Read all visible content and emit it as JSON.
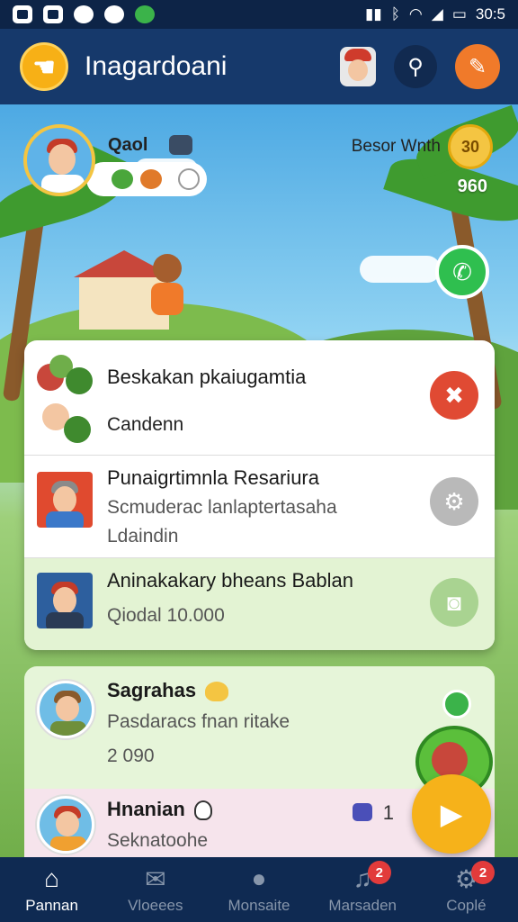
{
  "status_bar": {
    "time": "30:5",
    "icons": [
      "gallery-icon",
      "image-icon",
      "alarm-icon",
      "location-icon",
      "leaf-icon",
      "vibrate-icon",
      "bluetooth-icon",
      "wifi-icon",
      "signal-icon",
      "battery-icon"
    ]
  },
  "header": {
    "title": "Inagardoani",
    "back_icon": "back-hand-icon",
    "search_icon": "search-icon",
    "edit_icon": "pencil-icon"
  },
  "profile": {
    "name": "Qaol",
    "best_label": "Besor Wnth",
    "coin_value": "30",
    "coin_sub": "960"
  },
  "main_card": {
    "section1": {
      "title": "Beskakan pkaiugamtia",
      "subtitle": "Candenn"
    },
    "section2": {
      "title": "Punaigrtimnla Resariura",
      "line2": "Scmuderac lanlaptertasaha",
      "line3": "Ldaindin"
    },
    "section3": {
      "title": "Aninakakary bheans Bablan",
      "subtitle": "Qiodal 10.000"
    }
  },
  "lower_card": {
    "row1": {
      "title": "Sagrahas",
      "subtitle": "Pasdaracs fnan ritake",
      "value": "2 090"
    },
    "row2": {
      "title": "Hnanian",
      "subtitle": "Seknatoohe",
      "count": "1"
    }
  },
  "bottom_nav": [
    {
      "label": "Pannan",
      "icon": "home-icon",
      "active": true
    },
    {
      "label": "Vloeees",
      "icon": "mail-icon",
      "active": false
    },
    {
      "label": "Monsaite",
      "icon": "drop-icon",
      "active": false
    },
    {
      "label": "Marsaden",
      "icon": "music-icon",
      "active": false,
      "badge": "2"
    },
    {
      "label": "Coplé",
      "icon": "settings-icon",
      "active": false,
      "badge": "2"
    }
  ],
  "colors": {
    "header_bg": "#16396b",
    "nav_bg": "#0f2a52",
    "accent_orange": "#f07a2a",
    "accent_yellow": "#f6b21a",
    "close_red": "#e04a33",
    "green_highlight": "#e3f3d3"
  }
}
